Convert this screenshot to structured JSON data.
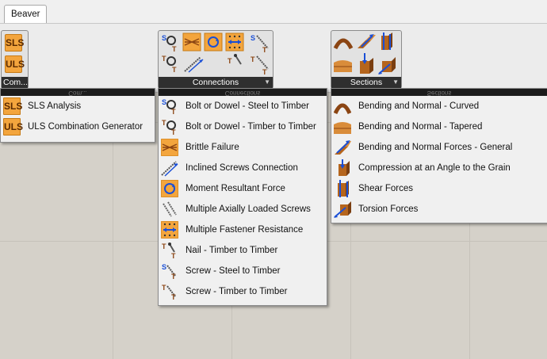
{
  "app": {
    "tab": "Beaver"
  },
  "ribbon": {
    "groups": [
      {
        "label": "Com...",
        "icons": [
          "sls-icon",
          "uls-icon"
        ]
      },
      {
        "label": "Connections",
        "icons": [
          "screw-steel-icon",
          "tangle-icon",
          "moment-icon",
          "fastener-icon",
          "screw-steel-icon",
          "bolt-timber-icon",
          "inclined-screws-icon",
          "nail-icon",
          "screw-timber-icon"
        ]
      },
      {
        "label": "Sections",
        "icons": [
          "curved-beam-icon",
          "forces-icon",
          "shear-icon",
          "tapered-beam-icon",
          "compression-icon",
          "torsion-icon"
        ]
      }
    ]
  },
  "menus": {
    "combinations": {
      "header": "Com...",
      "items": [
        {
          "label": "SLS Analysis",
          "icon": "sls-icon",
          "icon_text": "SLS"
        },
        {
          "label": "ULS Combination Generator",
          "icon": "uls-icon",
          "icon_text": "ULS"
        }
      ]
    },
    "connections": {
      "header": "Connections",
      "items": [
        {
          "label": "Bolt or Dowel - Steel to Timber",
          "icon": "bolt-steel-icon"
        },
        {
          "label": "Bolt or Dowel - Timber to Timber",
          "icon": "bolt-timber-icon"
        },
        {
          "label": "Brittle Failure",
          "icon": "brittle-failure-icon"
        },
        {
          "label": "Inclined Screws Connection",
          "icon": "inclined-screws-icon"
        },
        {
          "label": "Moment Resultant Force",
          "icon": "moment-icon"
        },
        {
          "label": "Multiple Axially Loaded Screws",
          "icon": "axial-screws-icon"
        },
        {
          "label": "Multiple Fastener Resistance",
          "icon": "fastener-icon"
        },
        {
          "label": "Nail - Timber to Timber",
          "icon": "nail-icon"
        },
        {
          "label": "Screw - Steel to Timber",
          "icon": "screw-steel-icon"
        },
        {
          "label": "Screw - Timber to Timber",
          "icon": "screw-timber-icon"
        }
      ]
    },
    "sections": {
      "header": "Sections",
      "items": [
        {
          "label": "Bending and Normal - Curved",
          "icon": "curved-beam-icon"
        },
        {
          "label": "Bending and Normal - Tapered",
          "icon": "tapered-beam-icon"
        },
        {
          "label": "Bending and Normal Forces - General",
          "icon": "forces-icon"
        },
        {
          "label": "Compression at an Angle to the Grain",
          "icon": "compression-icon"
        },
        {
          "label": "Shear Forces",
          "icon": "shear-icon"
        },
        {
          "label": "Torsion Forces",
          "icon": "torsion-icon"
        }
      ]
    }
  },
  "colors": {
    "accent_orange": "#f3a53d",
    "arrow_blue": "#1a4fd6",
    "wood_brown": "#8b4513",
    "menu_header": "#1c1c1c"
  }
}
